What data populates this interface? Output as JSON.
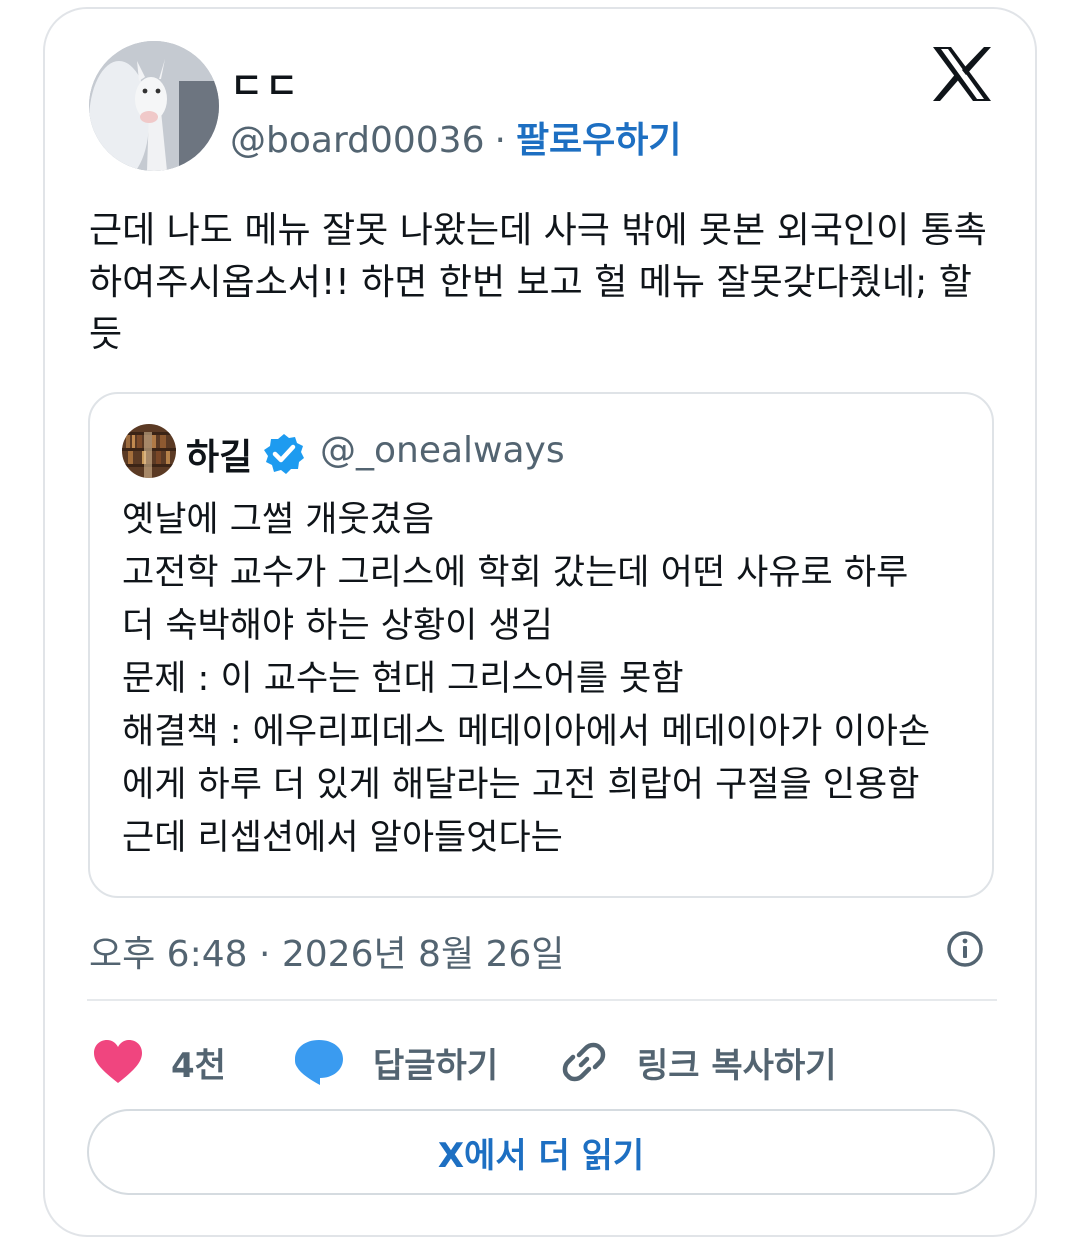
{
  "tweet": {
    "display_name": "ㄷㄷ",
    "handle": "@board00036",
    "separator": "·",
    "follow_label": "팔로우하기",
    "text": "근데 나도 메뉴 잘못 나왔는데 사극 밖에 못본 외국인이 통촉\n하여주시옵소서!! 하면 한번 보고 헐 메뉴 잘못갖다줬네; 할\n듯",
    "logo_icon": "x-logo-icon",
    "timestamp": "오후 6:48 · 2026년 8월 26일"
  },
  "quoted_tweet": {
    "display_name": "하길",
    "verified_icon": "verified-badge-icon",
    "handle": "@_onealways",
    "text": "옛날에 그썰 개웃겼음\n고전학 교수가 그리스에 학회 갔는데 어떤 사유로 하루\n더 숙박해야 하는 상황이 생김\n문제 : 이 교수는 현대 그리스어를 못함\n해결책 : 에우리피데스 메데이아에서 메데이아가 이아손\n에게 하루 더 있게 해달라는 고전 희랍어 구절을 인용함\n근데 리셉션에서 알아들엇다는"
  },
  "actions": {
    "like_count": "4천",
    "reply_label": "답글하기",
    "copy_link_label": "링크 복사하기"
  },
  "footer": {
    "read_more_label": "X에서 더 읽기"
  },
  "colors": {
    "accent": "#1d6fc2",
    "heart": "#f0457f",
    "reply_bubble": "#3a9bf0",
    "muted_text": "#536471"
  }
}
